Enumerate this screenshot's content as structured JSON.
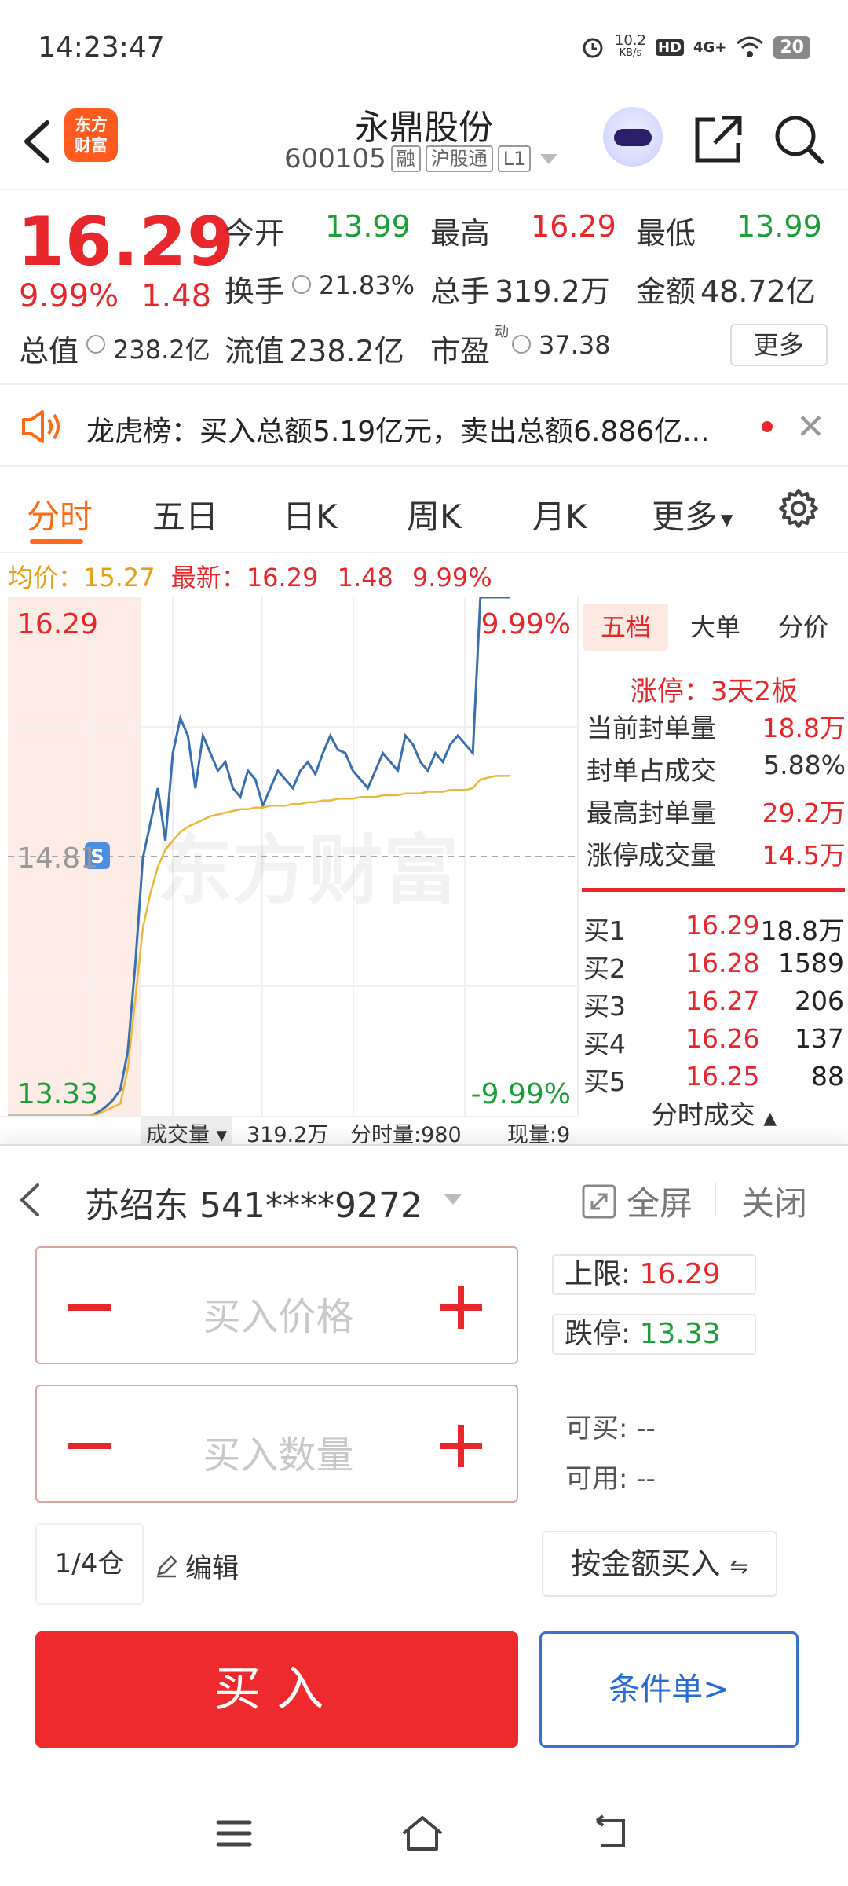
{
  "status": {
    "time": "14:23:47",
    "net_speed": "10.2",
    "net_unit": "KB/s",
    "hd": "HD",
    "signal": "4G+",
    "battery": "20"
  },
  "header": {
    "logo_line1": "东方",
    "logo_line2": "财富",
    "name": "永鼎股份",
    "code": "600105",
    "tags": [
      "融",
      "沪股通",
      "L1"
    ]
  },
  "quote": {
    "price": "16.29",
    "pct": "9.99%",
    "change": "1.48",
    "open_label": "今开",
    "open": "13.99",
    "high_label": "最高",
    "high": "16.29",
    "low_label": "最低",
    "low": "13.99",
    "turnover_label": "换手",
    "turnover": "21.83%",
    "volume_label": "总手",
    "volume": "319.2万",
    "amount_label": "金额",
    "amount": "48.72亿",
    "mktcap_label": "总值",
    "mktcap": "238.2亿",
    "float_label": "流值",
    "float": "238.2亿",
    "pe_label": "市盈",
    "pe_sup": "动",
    "pe": "37.38",
    "more": "更多"
  },
  "notice": {
    "text": "龙虎榜：买入总额5.19亿元，卖出总额6.886亿..."
  },
  "tabs": [
    "分时",
    "五日",
    "日K",
    "周K",
    "月K",
    "更多"
  ],
  "avg_row": {
    "avg_label": "均价：",
    "avg": "15.27",
    "latest_label": "最新：",
    "latest": "16.29",
    "chg": "1.48",
    "pct": "9.99%"
  },
  "chart_data": {
    "type": "line",
    "y_top": "16.29",
    "y_mid": "14.81",
    "y_bottom": "13.33",
    "pct_top": "9.99%",
    "pct_bottom": "-9.99%",
    "ylim": [
      13.33,
      16.29
    ],
    "prev_close": 14.81,
    "marker": "S",
    "watermark": "东方财富",
    "series": [
      {
        "values": [
          13.33,
          13.33,
          13.33,
          13.33,
          13.33,
          13.33,
          13.33,
          13.33,
          13.33,
          13.33,
          13.33,
          13.33,
          13.35,
          13.38,
          13.42,
          13.48,
          13.7,
          14.2,
          14.8,
          15.0,
          15.2,
          14.9,
          15.4,
          15.6,
          15.5,
          15.2,
          15.5,
          15.4,
          15.3,
          15.35,
          15.2,
          15.15,
          15.3,
          15.25,
          15.1,
          15.2,
          15.3,
          15.25,
          15.2,
          15.3,
          15.35,
          15.28,
          15.4,
          15.5,
          15.42,
          15.4,
          15.3,
          15.25,
          15.2,
          15.3,
          15.4,
          15.35,
          15.3,
          15.5,
          15.45,
          15.35,
          15.3,
          15.4,
          15.35,
          15.45,
          15.5,
          15.45,
          15.4,
          16.29,
          16.29,
          16.29,
          16.29,
          16.29
        ]
      },
      {
        "values": [
          13.33,
          13.33,
          13.33,
          13.33,
          13.33,
          13.33,
          13.33,
          13.33,
          13.33,
          13.33,
          13.33,
          13.33,
          13.34,
          13.36,
          13.38,
          13.4,
          13.6,
          14.0,
          14.4,
          14.6,
          14.75,
          14.85,
          14.9,
          14.95,
          14.98,
          15.0,
          15.02,
          15.04,
          15.05,
          15.06,
          15.07,
          15.08,
          15.08,
          15.09,
          15.09,
          15.1,
          15.1,
          15.1,
          15.11,
          15.11,
          15.12,
          15.12,
          15.13,
          15.13,
          15.14,
          15.14,
          15.14,
          15.15,
          15.15,
          15.15,
          15.16,
          15.16,
          15.16,
          15.17,
          15.17,
          15.17,
          15.18,
          15.18,
          15.18,
          15.19,
          15.19,
          15.19,
          15.2,
          15.25,
          15.26,
          15.27,
          15.27,
          15.27
        ]
      }
    ]
  },
  "book": {
    "tabs": [
      "五档",
      "大单",
      "分价"
    ],
    "limit_title": "涨停：3天2板",
    "stats": [
      {
        "label": "当前封单量",
        "value": "18.8万"
      },
      {
        "label": "封单占成交",
        "value": "5.88%"
      },
      {
        "label": "最高封单量",
        "value": "29.2万"
      },
      {
        "label": "涨停成交量",
        "value": "14.5万"
      }
    ],
    "bids": [
      {
        "label": "买1",
        "price": "16.29",
        "qty": "18.8万"
      },
      {
        "label": "买2",
        "price": "16.28",
        "qty": "1589"
      },
      {
        "label": "买3",
        "price": "16.27",
        "qty": "206"
      },
      {
        "label": "买4",
        "price": "16.26",
        "qty": "137"
      },
      {
        "label": "买5",
        "price": "16.25",
        "qty": "88"
      }
    ],
    "ticks": "分时成交"
  },
  "vol_strip": {
    "label": "成交量",
    "total": "319.2万",
    "tick": "分时量:980",
    "cur": "现量:9"
  },
  "panel": {
    "account": "苏绍东 541****9272",
    "fullscreen": "全屏",
    "close": "关闭",
    "price_placeholder": "买入价格",
    "qty_placeholder": "买入数量",
    "upper_label": "上限:",
    "upper": "16.29",
    "lower_label": "跌停:",
    "lower": "13.33",
    "can_buy_label": "可买:",
    "can_buy": "--",
    "can_use_label": "可用:",
    "can_use": "--",
    "position": "1/4仓",
    "edit": "编辑",
    "by_amount": "按金额买入",
    "buy": "买入",
    "conditional": "条件单>"
  },
  "colors": {
    "up": "#e8272c",
    "down": "#1e9e3a",
    "accent": "#ff6a1a",
    "price_line": "#3a6fb0",
    "avg_line": "#e8b93a"
  }
}
